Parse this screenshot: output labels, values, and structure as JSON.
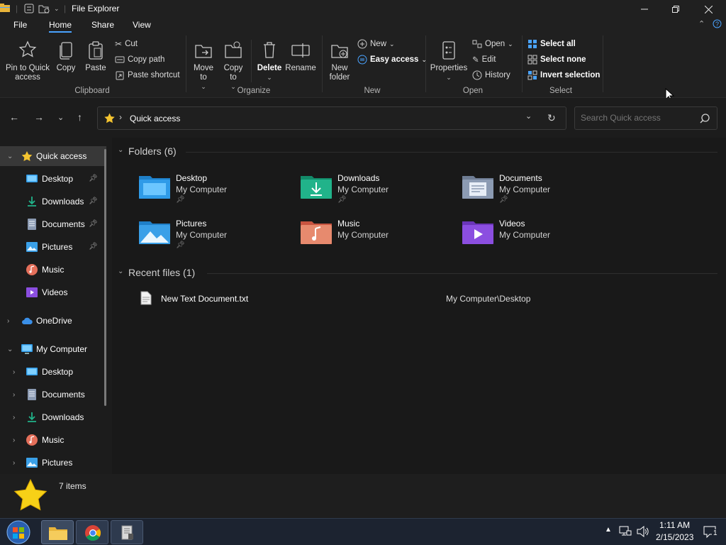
{
  "window": {
    "title": "File Explorer"
  },
  "tabs": [
    "File",
    "Home",
    "Share",
    "View"
  ],
  "ribbon": {
    "clipboard": {
      "pin": "Pin to Quick access",
      "copy": "Copy",
      "paste": "Paste",
      "cut": "Cut",
      "copy_path": "Copy path",
      "paste_shortcut": "Paste shortcut",
      "label": "Clipboard"
    },
    "organize": {
      "move_to": "Move to",
      "copy_to": "Copy to",
      "delete": "Delete",
      "rename": "Rename",
      "label": "Organize"
    },
    "new": {
      "new_folder": "New folder",
      "new_item": "New",
      "easy_access": "Easy access",
      "label": "New"
    },
    "open": {
      "properties": "Properties",
      "open": "Open",
      "edit": "Edit",
      "history": "History",
      "label": "Open"
    },
    "select": {
      "select_all": "Select all",
      "select_none": "Select none",
      "invert": "Invert selection",
      "label": "Select"
    }
  },
  "address": {
    "path": "Quick access",
    "search_placeholder": "Search Quick access"
  },
  "nav": {
    "quick_access": "Quick access",
    "qa_items": [
      "Desktop",
      "Downloads",
      "Documents",
      "Pictures",
      "Music",
      "Videos"
    ],
    "onedrive": "OneDrive",
    "my_computer": "My Computer",
    "mc_items": [
      "Desktop",
      "Documents",
      "Downloads",
      "Music",
      "Pictures"
    ]
  },
  "content": {
    "folders_header": "Folders (6)",
    "folders": [
      {
        "name": "Desktop",
        "location": "My Computer",
        "icon": "desktop-folder-icon",
        "color": "#2f9be8"
      },
      {
        "name": "Downloads",
        "location": "My Computer",
        "icon": "downloads-folder-icon",
        "color": "#21b38a"
      },
      {
        "name": "Documents",
        "location": "My Computer",
        "icon": "documents-folder-icon",
        "color": "#8c9bb3"
      },
      {
        "name": "Pictures",
        "location": "My Computer",
        "icon": "pictures-folder-icon",
        "color": "#3aa0e8"
      },
      {
        "name": "Music",
        "location": "My Computer",
        "icon": "music-folder-icon",
        "color": "#e46f5a"
      },
      {
        "name": "Videos",
        "location": "My Computer",
        "icon": "videos-folder-icon",
        "color": "#8b4ee0"
      }
    ],
    "recent_header": "Recent files (1)",
    "recent": [
      {
        "name": "New Text Document.txt",
        "path": "My Computer\\Desktop"
      }
    ]
  },
  "status": {
    "items": "7 items"
  },
  "taskbar": {
    "time": "1:11 AM",
    "date": "2/15/2023",
    "notifications": "1"
  }
}
